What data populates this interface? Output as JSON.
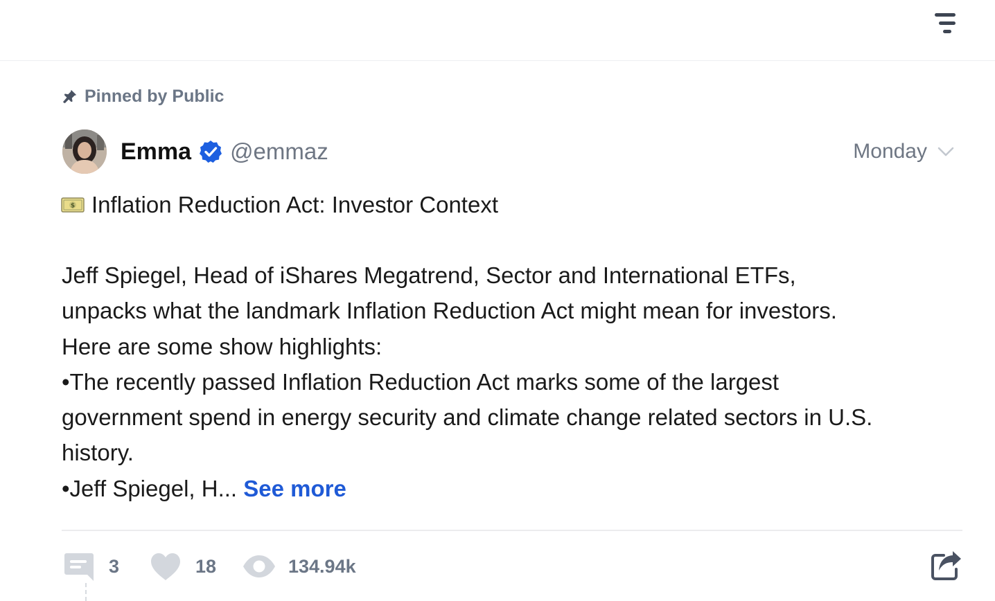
{
  "header": {
    "filter_icon": "filter-lines-icon"
  },
  "pinned": {
    "icon": "pin-icon",
    "label": "Pinned by Public"
  },
  "post": {
    "author": {
      "name": "Emma",
      "verified_icon": "verified-badge-icon",
      "verified_color": "#1d5fe0",
      "handle": "@emmaz"
    },
    "date": "Monday",
    "title_icon": "dollar-bill-icon",
    "title": "Inflation Reduction Act: Investor Context",
    "body_lines": [
      "Jeff Spiegel, Head of iShares Megatrend, Sector and International ETFs,",
      "unpacks what the landmark Inflation Reduction Act might mean for investors.",
      "Here are some show highlights:",
      "•The recently passed Inflation Reduction Act marks some of the largest",
      "government spend in energy security and climate change related sectors in U.S.",
      "history."
    ],
    "truncated_line": "•Jeff Spiegel, H...",
    "see_more": "See more",
    "see_more_color": "#1f5ad6"
  },
  "actions": {
    "comments": "3",
    "likes": "18",
    "views": "134.94k",
    "comment_icon": "comment-icon",
    "like_icon": "heart-icon",
    "view_icon": "eye-icon",
    "share_icon": "share-icon",
    "icon_color": "#d3d7dd"
  }
}
